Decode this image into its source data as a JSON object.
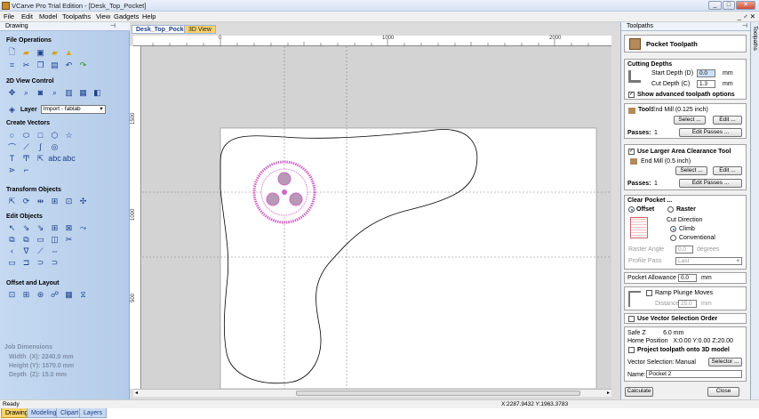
{
  "window": {
    "title": "VCarve Pro Trial Edition - [Desk_Top_Pocket]",
    "controls": [
      "_",
      "□",
      "✕"
    ]
  },
  "menu": {
    "items": [
      "File",
      "Edit",
      "Model",
      "Toolpaths",
      "View",
      "Gadgets",
      "Help"
    ],
    "right": "_ ♂ ✕"
  },
  "left_panel": {
    "header": "Drawing",
    "sections": {
      "file_operations": "File Operations",
      "view_control": "2D View Control",
      "create_vectors": "Create Vectors",
      "transform": "Transform Objects",
      "edit": "Edit Objects",
      "offset": "Offset and Layout"
    },
    "layer_label": "Layer",
    "layer_value": "Import - fablab",
    "job_dimensions": {
      "title": "Job Dimensions",
      "width": "Width  (X): 2240.0 mm",
      "height": "Height (Y): 1570.0 mm",
      "depth": "Depth  (Z): 15.0 mm"
    },
    "tabs": [
      "Drawing",
      "Modeling",
      "Clipart",
      "Layers"
    ]
  },
  "document": {
    "tabs": [
      "Desk_Top_Pocket",
      "3D View"
    ],
    "ruler_h": [
      "0",
      "1000",
      "2000"
    ],
    "ruler_v": [
      "1500",
      "1000",
      "500"
    ]
  },
  "right_panel": {
    "header": "Toolpaths",
    "vertical_tab": "Toolpaths",
    "title": "Pocket Toolpath",
    "cutting_depths": {
      "label": "Cutting Depths",
      "start_depth_label": "Start Depth (D)",
      "start_depth_value": "0.0",
      "cut_depth_label": "Cut Depth (C)",
      "cut_depth_value": "1.3",
      "unit": "mm",
      "advanced": "Show advanced toolpath options"
    },
    "tool": {
      "label": "Tool:",
      "value": "End Mill (0.125 inch)",
      "select": "Select ...",
      "edit": "Edit ..."
    },
    "passes1": {
      "label": "Passes:",
      "value": "1",
      "button": "Edit Passes ..."
    },
    "clearance": {
      "label": "Use Larger Area Clearance Tool",
      "tool": "End Mill (0.5 inch)",
      "select": "Select ...",
      "edit": "Edit ..."
    },
    "passes2": {
      "label": "Passes:",
      "value": "1",
      "button": "Edit Passes ..."
    },
    "clear_pocket": {
      "label": "Clear Pocket ...",
      "offset": "Offset",
      "raster": "Raster",
      "cut_direction": "Cut Direction",
      "climb": "Climb",
      "conventional": "Conventional",
      "raster_angle_label": "Raster Angle",
      "raster_angle_value": "0.0",
      "raster_angle_unit": "degrees",
      "profile_pass_label": "Profile Pass",
      "profile_pass_value": "Last"
    },
    "pocket_allowance": {
      "label": "Pocket Allowance",
      "value": "0.0",
      "unit": "mm"
    },
    "ramp": {
      "label": "Ramp Plunge Moves",
      "distance_label": "Distance",
      "distance_value": "25.0",
      "unit": "mm"
    },
    "vector_order": "Use Vector Selection Order",
    "safe_z": "Safe Z          6.0 mm",
    "home": "Home Position   X:0.00 Y:0.00 Z:20.00",
    "project": "Project toolpath onto 3D model",
    "vector_selection": {
      "label": "Vector Selection:",
      "value": "Manual",
      "button": "Selector ..."
    },
    "name": {
      "label": "Name:",
      "value": "Pocket 2"
    },
    "calculate": "Calculate",
    "close": "Close"
  },
  "status": {
    "left": "Ready",
    "coords": "X:2287.9432 Y:1963.3783"
  },
  "colors": {
    "accent": "#1f5fbf",
    "panel": "#c5d9f1",
    "selection": "#d066c8"
  }
}
